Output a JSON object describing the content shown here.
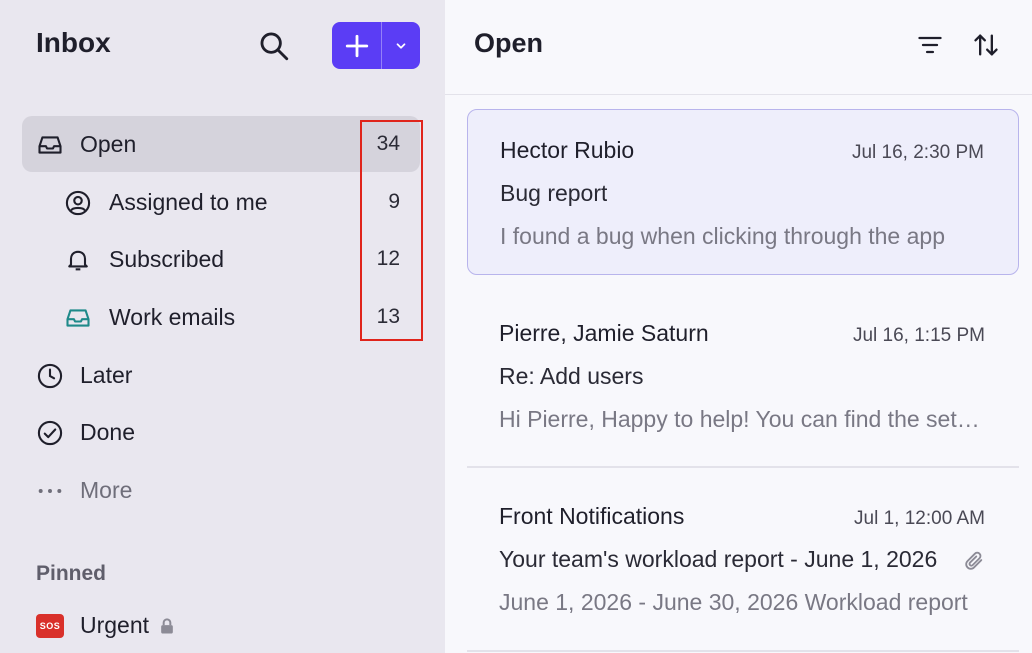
{
  "sidebar": {
    "title": "Inbox",
    "nav": [
      {
        "label": "Open",
        "count": "34"
      },
      {
        "label": "Assigned to me",
        "count": "9"
      },
      {
        "label": "Subscribed",
        "count": "12"
      },
      {
        "label": "Work emails",
        "count": "13"
      },
      {
        "label": "Later"
      },
      {
        "label": "Done"
      },
      {
        "label": "More"
      }
    ],
    "pinned_heading": "Pinned",
    "pinned": [
      {
        "label": "Urgent",
        "badge": "SOS"
      }
    ]
  },
  "main": {
    "title": "Open",
    "conversations": [
      {
        "sender": "Hector Rubio",
        "time": "Jul 16, 2:30 PM",
        "subject": "Bug report",
        "preview": "I found a bug when clicking through the app"
      },
      {
        "sender": "Pierre, Jamie Saturn",
        "time": "Jul 16, 1:15 PM",
        "subject": "Re: Add users",
        "preview": "Hi Pierre, Happy to help! You can find the settings"
      },
      {
        "sender": "Front Notifications",
        "time": "Jul 1, 12:00 AM",
        "subject": "Your team's workload report - June 1, 2026",
        "preview": "June 1, 2026 - June 30, 2026 Workload report"
      }
    ]
  },
  "colors": {
    "accent": "#5b3df5",
    "highlight": "#e0241b",
    "work_emails_icon": "#1f8a8a"
  },
  "icons": {
    "search": "search-icon",
    "new": "plus-icon",
    "dropdown": "chevron-down-icon",
    "open": "inbox-tray-icon",
    "assigned": "user-circle-icon",
    "subscribed": "bell-icon",
    "work_emails": "inbox-tray-icon",
    "later": "clock-icon",
    "done": "check-circle-icon",
    "more": "ellipsis-icon",
    "lock": "lock-icon",
    "filter": "filter-icon",
    "sort": "sort-icon",
    "attachment": "paperclip-icon"
  }
}
